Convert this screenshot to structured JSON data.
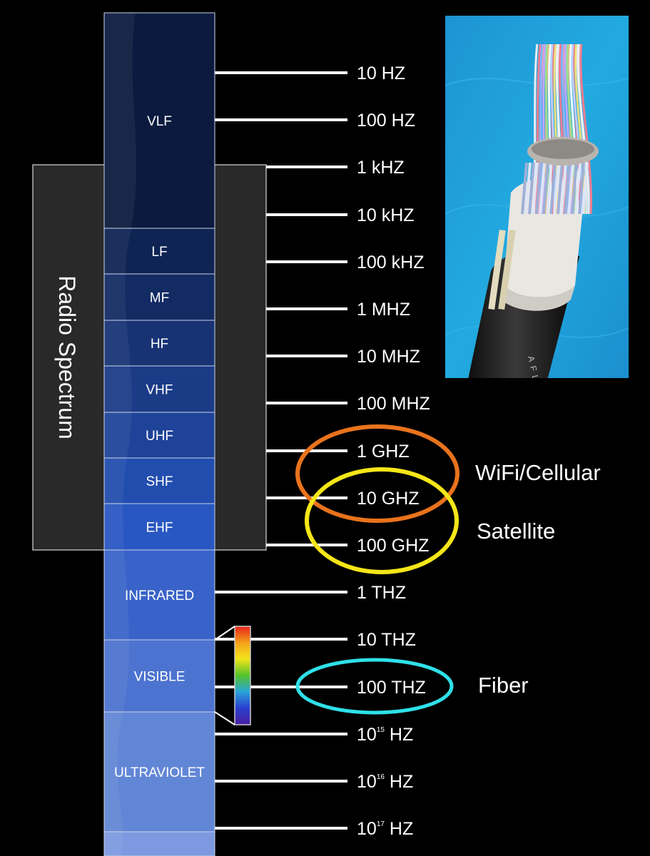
{
  "radio_group_label": "Radio Spectrum",
  "bands": [
    {
      "label": "VLF",
      "color": "#0b1a3e"
    },
    {
      "label": "LF",
      "color": "#0f2453"
    },
    {
      "label": "MF",
      "color": "#132b63"
    },
    {
      "label": "HF",
      "color": "#173374"
    },
    {
      "label": "VHF",
      "color": "#1b3b87"
    },
    {
      "label": "UHF",
      "color": "#1e4398"
    },
    {
      "label": "SHF",
      "color": "#214dae"
    },
    {
      "label": "EHF",
      "color": "#2957c2"
    },
    {
      "label": "INFRARED",
      "color": "#3963c8"
    },
    {
      "label": "VISIBLE",
      "color": "#4c73cf"
    },
    {
      "label": "ULTRAVIOLET",
      "color": "#6286d6"
    },
    {
      "label": "",
      "color": "#7d9ae0"
    }
  ],
  "frequencies": [
    {
      "base": "10 HZ",
      "exp": "",
      "unit": ""
    },
    {
      "base": "100 HZ",
      "exp": "",
      "unit": ""
    },
    {
      "base": "1 kHZ",
      "exp": "",
      "unit": ""
    },
    {
      "base": "10 kHZ",
      "exp": "",
      "unit": ""
    },
    {
      "base": "100 kHZ",
      "exp": "",
      "unit": ""
    },
    {
      "base": "1 MHZ",
      "exp": "",
      "unit": ""
    },
    {
      "base": "10 MHZ",
      "exp": "",
      "unit": ""
    },
    {
      "base": "100 MHZ",
      "exp": "",
      "unit": ""
    },
    {
      "base": "1 GHZ",
      "exp": "",
      "unit": ""
    },
    {
      "base": "10 GHZ",
      "exp": "",
      "unit": ""
    },
    {
      "base": "100 GHZ",
      "exp": "",
      "unit": ""
    },
    {
      "base": "1 THZ",
      "exp": "",
      "unit": ""
    },
    {
      "base": "10 THZ",
      "exp": "",
      "unit": ""
    },
    {
      "base": "100 THZ",
      "exp": "",
      "unit": ""
    },
    {
      "base": "10",
      "exp": "15",
      "unit": " HZ"
    },
    {
      "base": "10",
      "exp": "16",
      "unit": " HZ"
    },
    {
      "base": "10",
      "exp": "17",
      "unit": " HZ"
    }
  ],
  "highlights": [
    {
      "label": "WiFi/Cellular",
      "color": "#e8731c"
    },
    {
      "label": "Satellite",
      "color": "#f5e619"
    },
    {
      "label": "Fiber",
      "color": "#2fe0e8"
    }
  ],
  "spectrum_bar_colors": [
    "#e8221b",
    "#f5a31b",
    "#f2e51a",
    "#52c22a",
    "#2aa5d8",
    "#2a3fcf",
    "#4a1fa0"
  ],
  "photo_background": "#1aa1dc"
}
